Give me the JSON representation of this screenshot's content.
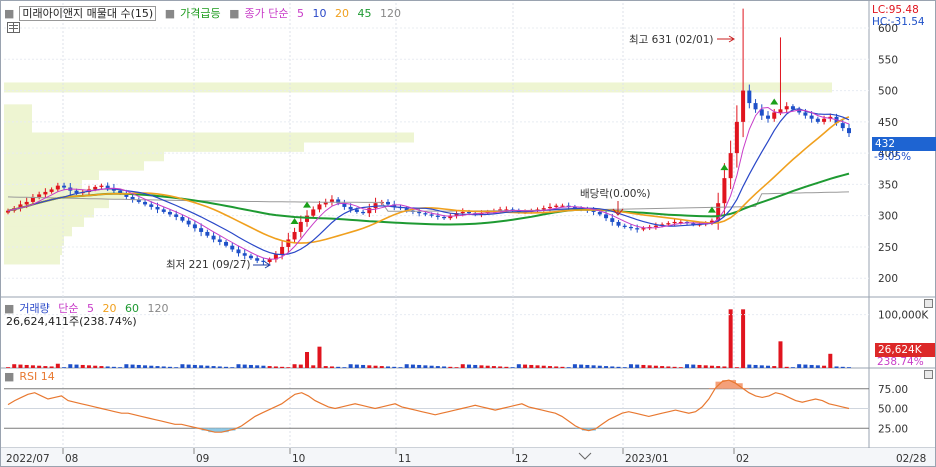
{
  "legend_main": {
    "title": "미래아이앤지 매물대 수(15)",
    "surge": "가격급등",
    "ma_title": "종가 단순",
    "ma_periods": [
      "5",
      "10",
      "20",
      "45",
      "120"
    ]
  },
  "legend_volume": {
    "title": "거래량",
    "ma_title": "단순",
    "ma_periods": [
      "5",
      "20",
      "60",
      "120"
    ],
    "current": "26,624,411주(238.74%)"
  },
  "legend_rsi": {
    "title": "RSI 14"
  },
  "price_info": {
    "lc": "LC:95.48",
    "hc": "HC:-31.54"
  },
  "annotations": {
    "high": "최고 631 (02/01)",
    "low": "최저 221 (09/27)",
    "dividend": "배당락(0.00%)"
  },
  "price_axis": [
    "600",
    "550",
    "500",
    "450",
    "400",
    "350",
    "300",
    "250",
    "200"
  ],
  "current_price": "432",
  "current_change": "-9.05%",
  "volume_axis": [
    "100,000K"
  ],
  "volume_current": "26,624K",
  "volume_current_pct": "238.74%",
  "rsi_axis": [
    "75.00",
    "50.00",
    "25.00"
  ],
  "date_axis": [
    "2022/07",
    "08",
    "09",
    "10",
    "11",
    "12",
    "2023/01",
    "02",
    "02/28"
  ],
  "colors": {
    "up": "#e0141e",
    "down": "#1e50c8",
    "ma5": "#c83cc8",
    "ma10": "#2a48c8",
    "ma20": "#f0a01e",
    "ma45": "#1e9a32",
    "ma120": "#9a9a9a",
    "rsi": "#e87830",
    "volume_profile": "#eef5d2",
    "current_badge": "#1e64d2",
    "volume_badge": "#dc2828"
  },
  "chart_data": {
    "type": "candlestick",
    "price_ylim": [
      170,
      640
    ],
    "volume_ylim": [
      0,
      120000
    ],
    "rsi_ylim": [
      0,
      100
    ],
    "rsi_levels": [
      75,
      50,
      25
    ],
    "price_path": [
      308,
      312,
      318,
      322,
      330,
      334,
      338,
      342,
      348,
      345,
      340,
      336,
      338,
      342,
      346,
      348,
      344,
      340,
      336,
      330,
      326,
      322,
      318,
      314,
      310,
      306,
      302,
      298,
      292,
      286,
      280,
      274,
      268,
      262,
      258,
      252,
      246,
      240,
      236,
      232,
      228,
      226,
      230,
      238,
      250,
      262,
      274,
      290,
      300,
      310,
      318,
      322,
      326,
      320,
      314,
      310,
      306,
      304,
      312,
      320,
      322,
      318,
      314,
      312,
      308,
      306,
      304,
      302,
      300,
      298,
      296,
      300,
      304,
      306,
      304,
      302,
      304,
      306,
      308,
      310,
      310,
      308,
      306,
      306,
      308,
      310,
      312,
      314,
      316,
      316,
      314,
      312,
      310,
      308,
      306,
      302,
      296,
      290,
      284,
      282,
      280,
      278,
      280,
      282,
      284,
      286,
      288,
      290,
      290,
      288,
      286,
      286,
      288,
      292,
      320,
      360,
      400,
      450,
      500,
      480,
      470,
      460,
      455,
      465,
      470,
      475,
      470,
      465,
      460,
      455,
      450,
      455,
      458,
      448,
      440,
      432
    ],
    "volume_spikes": [
      {
        "i": 8,
        "v": 8000
      },
      {
        "i": 48,
        "v": 30000
      },
      {
        "i": 50,
        "v": 40000
      },
      {
        "i": 116,
        "v": 110000
      },
      {
        "i": 118,
        "v": 110000
      },
      {
        "i": 124,
        "v": 50000
      },
      {
        "i": 132,
        "v": 26624
      }
    ],
    "rsi_path": [
      55,
      60,
      64,
      68,
      70,
      66,
      62,
      64,
      66,
      60,
      58,
      56,
      54,
      52,
      50,
      48,
      46,
      44,
      44,
      42,
      40,
      38,
      36,
      34,
      32,
      30,
      30,
      28,
      26,
      24,
      22,
      20,
      20,
      22,
      24,
      28,
      34,
      40,
      44,
      48,
      52,
      56,
      62,
      68,
      70,
      66,
      60,
      56,
      52,
      50,
      52,
      54,
      56,
      54,
      52,
      50,
      52,
      54,
      56,
      52,
      50,
      48,
      46,
      44,
      42,
      44,
      46,
      48,
      50,
      52,
      54,
      52,
      50,
      48,
      50,
      52,
      54,
      56,
      52,
      50,
      48,
      46,
      44,
      40,
      34,
      28,
      24,
      22,
      24,
      30,
      36,
      40,
      44,
      46,
      44,
      42,
      40,
      42,
      44,
      46,
      48,
      46,
      44,
      46,
      52,
      62,
      76,
      84,
      86,
      82,
      76,
      70,
      66,
      64,
      66,
      70,
      68,
      64,
      60,
      58,
      60,
      62,
      60,
      56,
      54,
      52,
      50
    ]
  }
}
